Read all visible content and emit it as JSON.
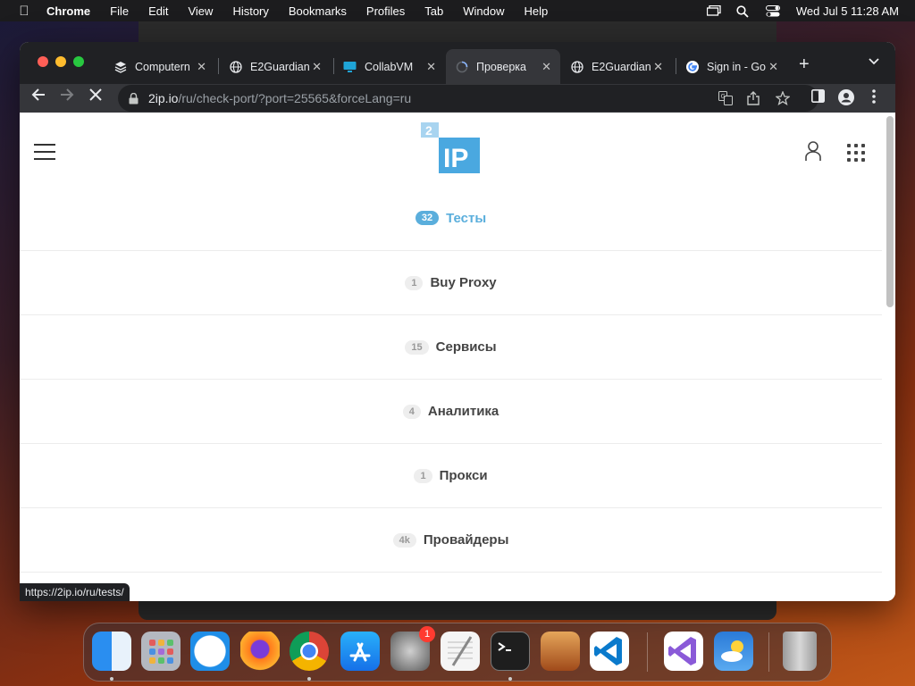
{
  "menubar": {
    "app": "Chrome",
    "items": [
      "File",
      "Edit",
      "View",
      "History",
      "Bookmarks",
      "Profiles",
      "Tab",
      "Window",
      "Help"
    ],
    "clock": "Wed Jul 5  11:28 AM"
  },
  "tabs": [
    {
      "title": "Computern",
      "icon": "stack-icon",
      "active": false
    },
    {
      "title": "E2Guardian",
      "icon": "globe-icon",
      "active": false
    },
    {
      "title": "CollabVM",
      "icon": "monitor-icon",
      "active": false
    },
    {
      "title": "Проверка",
      "icon": "loading-icon",
      "active": true
    },
    {
      "title": "E2Guardian",
      "icon": "globe-icon",
      "active": false
    },
    {
      "title": "Sign in - Go",
      "icon": "google-icon",
      "active": false
    }
  ],
  "address": {
    "host": "2ip.io",
    "path": "/ru/check-port/?port=25565&forceLang=ru"
  },
  "site": {
    "logo_small": "2",
    "logo_main": "IP"
  },
  "nav": [
    {
      "badge": "32",
      "label": "Тесты",
      "active": true
    },
    {
      "badge": "1",
      "label": "Buy Proxy",
      "active": false
    },
    {
      "badge": "15",
      "label": "Сервисы",
      "active": false
    },
    {
      "badge": "4",
      "label": "Аналитика",
      "active": false
    },
    {
      "badge": "1",
      "label": "Прокси",
      "active": false
    },
    {
      "badge": "4k",
      "label": "Провайдеры",
      "active": false
    }
  ],
  "status_url": "https://2ip.io/ru/tests/",
  "dock": {
    "apps": [
      "Finder",
      "Launchpad",
      "Safari",
      "Firefox",
      "Chrome",
      "App Store",
      "System Preferences",
      "TextEdit",
      "Terminal",
      "GarageBand",
      "VS Code",
      "Visual Studio",
      "Weather",
      "Trash"
    ],
    "settings_badge": "1"
  },
  "colors": {
    "accent": "#5aaedc",
    "logo_blue": "#4aa8e0"
  }
}
